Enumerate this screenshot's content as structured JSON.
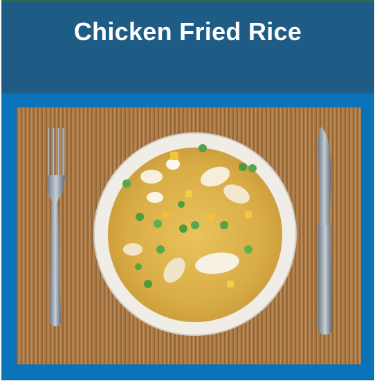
{
  "recipe": {
    "title": "Chicken Fried Rice"
  },
  "photo": {
    "subject": "fried-rice-bowl",
    "items": [
      "fork-icon",
      "bowl",
      "knife-icon"
    ]
  },
  "colors": {
    "card_background": "#0a73b9",
    "header_background": "#1e5c86",
    "accent_line": "#2f6b46",
    "title_text": "#ffffff"
  }
}
